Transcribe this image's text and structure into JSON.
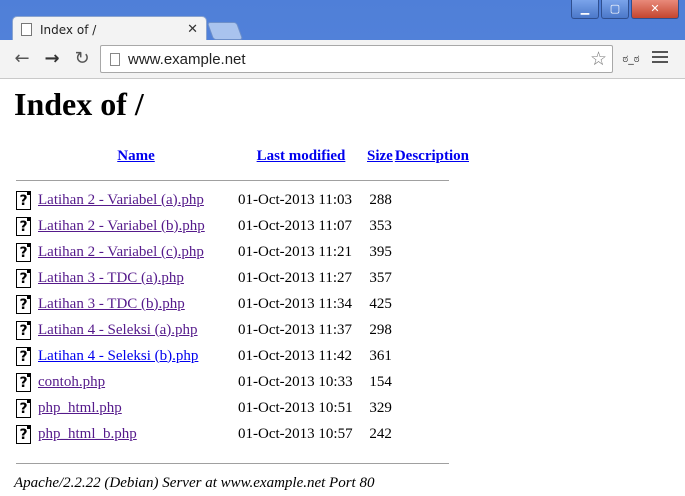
{
  "browser": {
    "tab_title": "Index of /",
    "url": "www.example.net",
    "window_controls": {
      "minimize": "▁",
      "maximize": "▢",
      "close": "✕"
    },
    "ext_label": "ಠ_ಠ"
  },
  "page": {
    "heading": "Index of /",
    "columns": {
      "name": "Name",
      "last_modified": "Last modified",
      "size": "Size",
      "description": "Description"
    },
    "files": [
      {
        "name": "Latihan 2 - Variabel (a).php",
        "modified": "01-Oct-2013 11:03",
        "size": "288"
      },
      {
        "name": "Latihan 2 - Variabel (b).php",
        "modified": "01-Oct-2013 11:07",
        "size": "353"
      },
      {
        "name": "Latihan 2 - Variabel (c).php",
        "modified": "01-Oct-2013 11:21",
        "size": "395"
      },
      {
        "name": "Latihan 3 - TDC (a).php",
        "modified": "01-Oct-2013 11:27",
        "size": "357"
      },
      {
        "name": "Latihan 3 - TDC (b).php",
        "modified": "01-Oct-2013 11:34",
        "size": "425"
      },
      {
        "name": "Latihan 4 - Seleksi (a).php",
        "modified": "01-Oct-2013 11:37",
        "size": "298"
      },
      {
        "name": "Latihan 4 - Seleksi (b).php",
        "modified": "01-Oct-2013 11:42",
        "size": "361"
      },
      {
        "name": "contoh.php",
        "modified": "01-Oct-2013 10:33",
        "size": "154"
      },
      {
        "name": "php_html.php",
        "modified": "01-Oct-2013 10:51",
        "size": "329"
      },
      {
        "name": "php_html_b.php",
        "modified": "01-Oct-2013 10:57",
        "size": "242"
      }
    ],
    "footer": "Apache/2.2.22 (Debian) Server at www.example.net Port 80"
  },
  "colors": {
    "link": "#0000ee",
    "visited": "#551a8b",
    "frame": "#5a86d6"
  },
  "icons": [
    "page-icon",
    "close-icon",
    "back-icon",
    "forward-icon",
    "reload-icon",
    "star-icon",
    "menu-icon",
    "unknown-file-icon"
  ]
}
